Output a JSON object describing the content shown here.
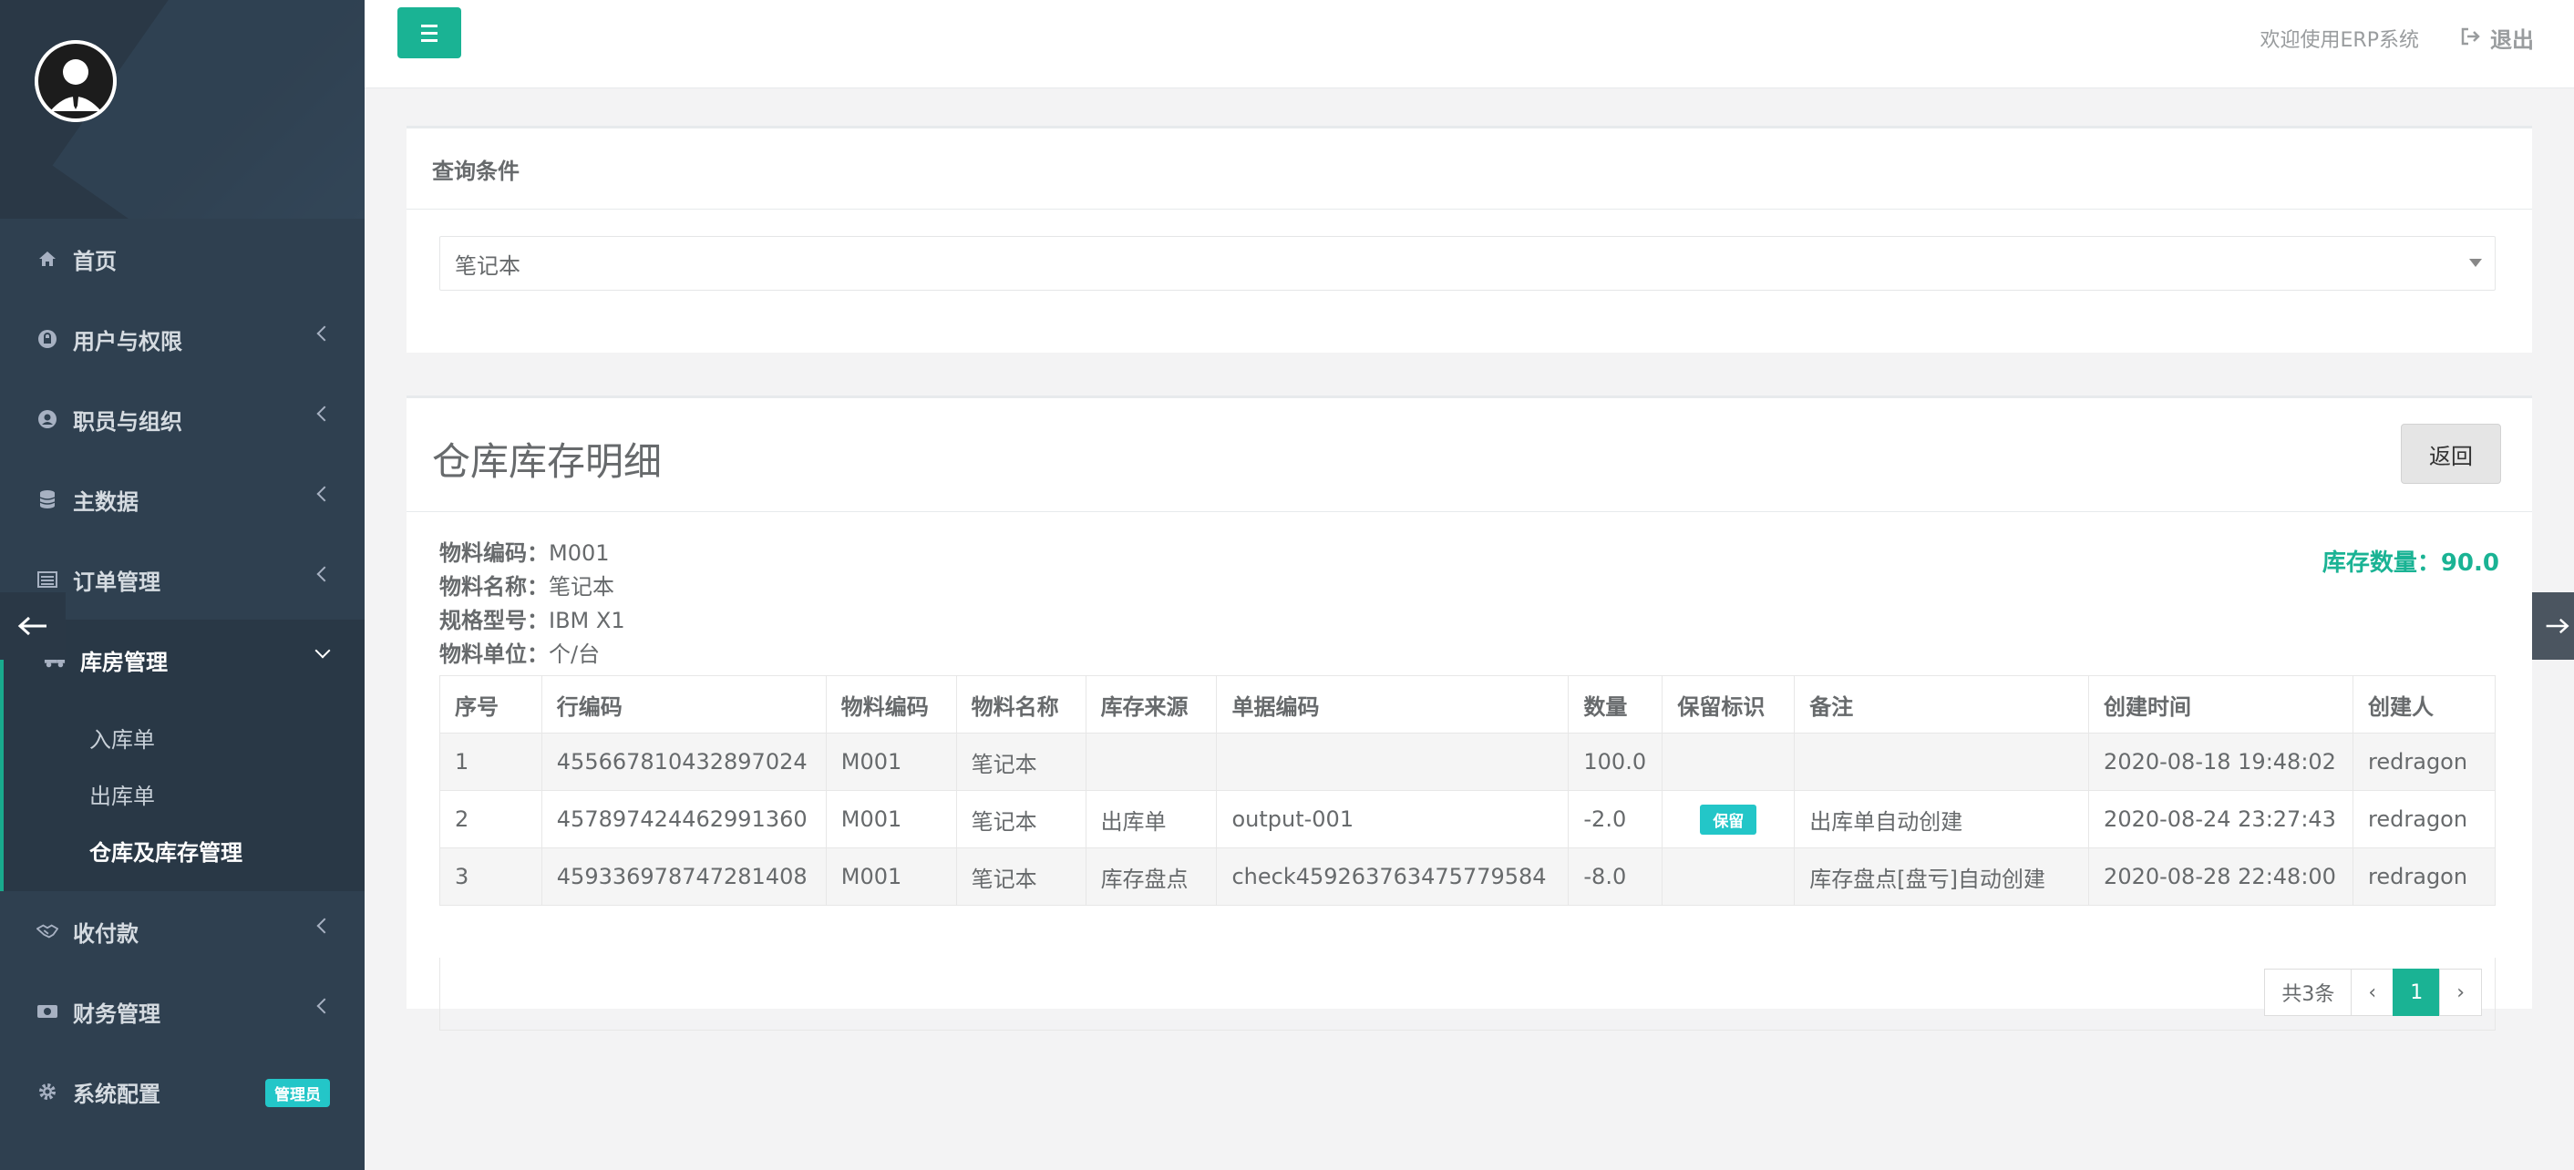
{
  "sidebar": {
    "items": [
      {
        "label": "首页",
        "icon": "home-icon"
      },
      {
        "label": "用户与权限",
        "icon": "lock-icon"
      },
      {
        "label": "职员与组织",
        "icon": "user-icon"
      },
      {
        "label": "主数据",
        "icon": "database-icon"
      },
      {
        "label": "订单管理",
        "icon": "list-icon"
      },
      {
        "label": "库房管理",
        "icon": "truck-icon"
      },
      {
        "label": "收付款",
        "icon": "handshake-icon"
      },
      {
        "label": "财务管理",
        "icon": "money-icon"
      },
      {
        "label": "系统配置",
        "icon": "gear-icon"
      }
    ],
    "subitems": [
      "入库单",
      "出库单",
      "仓库及库存管理"
    ],
    "admin_badge": "管理员"
  },
  "topbar": {
    "welcome": "欢迎使用ERP系统",
    "logout": "退出"
  },
  "query": {
    "title": "查询条件",
    "selected": "笔记本"
  },
  "detail": {
    "title": "仓库库存明细",
    "back_button": "返回",
    "info": [
      {
        "label": "物料编码：",
        "value": "M001"
      },
      {
        "label": "物料名称：",
        "value": "笔记本"
      },
      {
        "label": "规格型号：",
        "value": "IBM X1"
      },
      {
        "label": "物料单位：",
        "value": "个/台"
      }
    ],
    "stock_label": "库存数量：",
    "stock_value": "90.0"
  },
  "table": {
    "headers": [
      "序号",
      "行编码",
      "物料编码",
      "物料名称",
      "库存来源",
      "单据编码",
      "数量",
      "保留标识",
      "备注",
      "创建时间",
      "创建人"
    ],
    "rows": [
      [
        "1",
        "455667810432897024",
        "M001",
        "笔记本",
        "",
        "",
        "100.0",
        "",
        "",
        "2020-08-18 19:48:02",
        "redragon"
      ],
      [
        "2",
        "457897424462991360",
        "M001",
        "笔记本",
        "出库单",
        "output-001",
        "-2.0",
        "保留",
        "出库单自动创建",
        "2020-08-24 23:27:43",
        "redragon"
      ],
      [
        "3",
        "459336978747281408",
        "M001",
        "笔记本",
        "库存盘点",
        "check459263763475779584",
        "-8.0",
        "",
        "库存盘点[盘亏]自动创建",
        "2020-08-28 22:48:00",
        "redragon"
      ]
    ]
  },
  "pager": {
    "total": "共3条",
    "prev": "‹",
    "page": "1",
    "next": "›"
  },
  "colors": {
    "accent": "#1ab394",
    "sidebar": "#2f4050",
    "badge": "#23c6c8"
  }
}
